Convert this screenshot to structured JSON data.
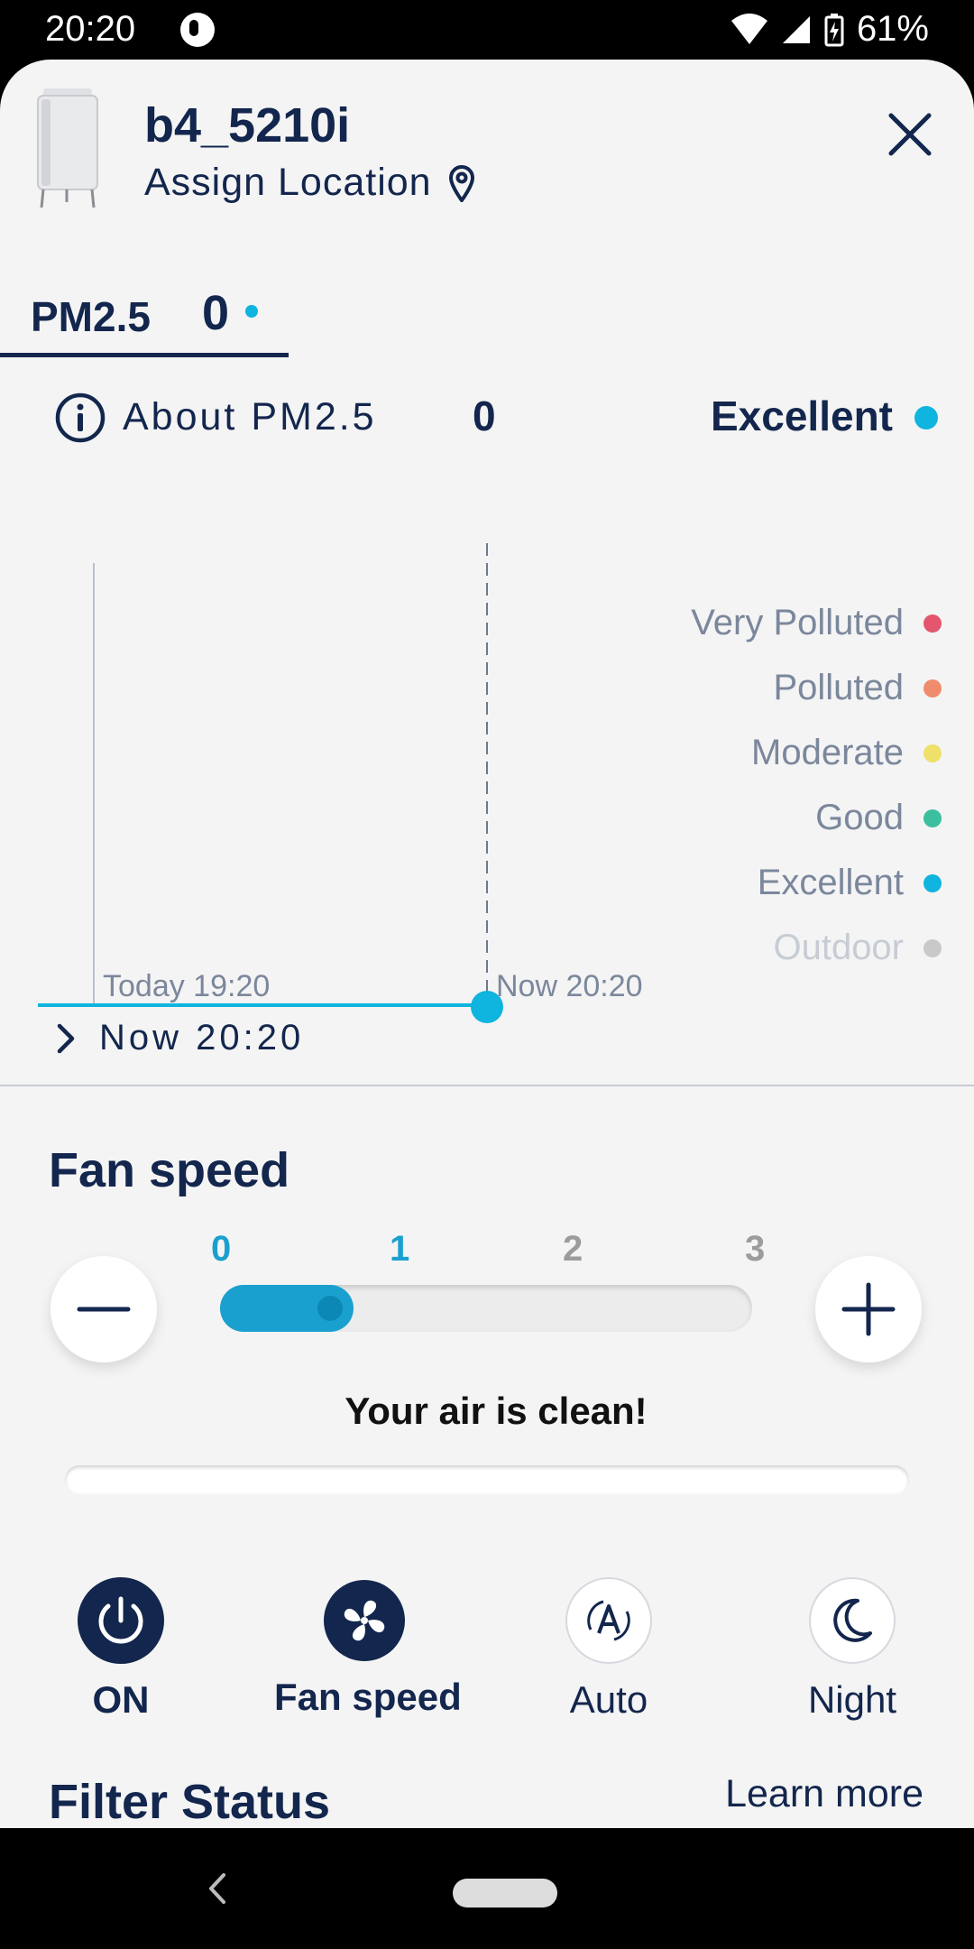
{
  "status_bar": {
    "time": "20:20",
    "battery_text": "61%"
  },
  "device": {
    "name": "b4_5210i",
    "assign_location": "Assign Location"
  },
  "tab": {
    "label": "PM2.5",
    "value": "0"
  },
  "about": {
    "label": "About PM2.5",
    "value": "0",
    "status": "Excellent",
    "status_color": "#0fb4df"
  },
  "chart": {
    "start_label": "Today 19:20",
    "now_label": "Now 20:20",
    "line_color": "#0fb4df",
    "legend": [
      {
        "label": "Very Polluted",
        "color": "#e3566d"
      },
      {
        "label": "Polluted",
        "color": "#f08c6e"
      },
      {
        "label": "Moderate",
        "color": "#efe06a"
      },
      {
        "label": "Good",
        "color": "#3cbf9e"
      },
      {
        "label": "Excellent",
        "color": "#0fb4df"
      },
      {
        "label": "Outdoor",
        "color": "#c9c9c9"
      }
    ]
  },
  "chart_data": {
    "type": "line",
    "x": [
      "Today 19:20",
      "Now 20:20"
    ],
    "series": [
      {
        "values": [
          0,
          0
        ]
      }
    ]
  },
  "now_row": {
    "label": "Now 20:20"
  },
  "fan_speed": {
    "title": "Fan speed",
    "steps": [
      "0",
      "1",
      "2",
      "3"
    ],
    "current": 1,
    "max": 3,
    "active_color": "#1aa0cf",
    "inactive_color": "#9c9c9c"
  },
  "air_status": {
    "text": "Your air is clean!"
  },
  "modes": [
    {
      "label": "ON",
      "icon": "power-icon",
      "active": true
    },
    {
      "label": "Fan speed",
      "icon": "fan-icon",
      "active": true
    },
    {
      "label": "Auto",
      "icon": "auto-icon",
      "active": false
    },
    {
      "label": "Night",
      "icon": "moon-icon",
      "active": false
    }
  ],
  "filter": {
    "title": "Filter Status",
    "learn_more": "Learn more"
  }
}
